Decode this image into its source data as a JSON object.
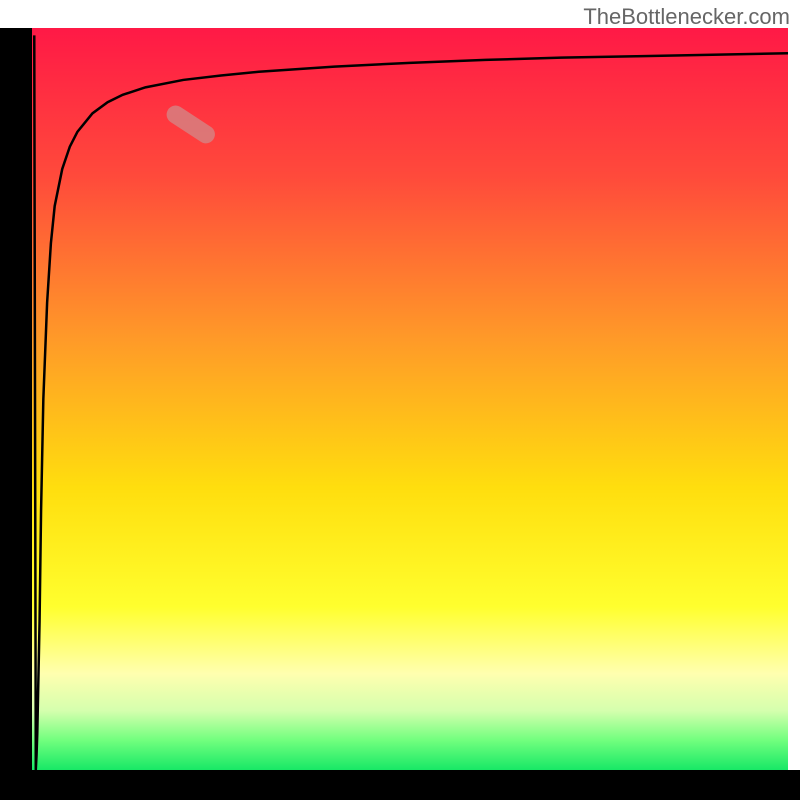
{
  "watermark": "TheBottlenecker.com",
  "chart_data": {
    "type": "line",
    "title": "",
    "xlabel": "",
    "ylabel": "",
    "xlim": [
      0,
      100
    ],
    "ylim": [
      0,
      100
    ],
    "background_gradient": {
      "stops": [
        {
          "offset": 0,
          "color": "#ff1946"
        },
        {
          "offset": 20,
          "color": "#ff4a3b"
        },
        {
          "offset": 42,
          "color": "#ff9a28"
        },
        {
          "offset": 62,
          "color": "#ffde0e"
        },
        {
          "offset": 78,
          "color": "#ffff2e"
        },
        {
          "offset": 87,
          "color": "#ffffaf"
        },
        {
          "offset": 92,
          "color": "#d5ffae"
        },
        {
          "offset": 96,
          "color": "#71ff7e"
        },
        {
          "offset": 100,
          "color": "#17e866"
        }
      ]
    },
    "curve": {
      "x": [
        0.5,
        0.6,
        0.7,
        0.8,
        1,
        1.2,
        1.5,
        2,
        2.5,
        3,
        4,
        5,
        6,
        8,
        10,
        12,
        15,
        20,
        25,
        30,
        40,
        50,
        60,
        70,
        80,
        90,
        100
      ],
      "y": [
        0,
        2,
        5,
        10,
        20,
        35,
        50,
        63,
        71,
        76,
        81,
        84,
        86,
        88.5,
        90,
        91,
        92,
        93,
        93.6,
        94.1,
        94.8,
        95.3,
        95.7,
        96,
        96.2,
        96.4,
        96.6
      ],
      "description": "Decreasing bottleneck curve that dips from top to near bottom then asymptotically approaches top-right"
    },
    "highlight": {
      "x_range": [
        18,
        24
      ],
      "y_range": [
        85,
        89
      ],
      "color": "#d28a8a"
    }
  }
}
